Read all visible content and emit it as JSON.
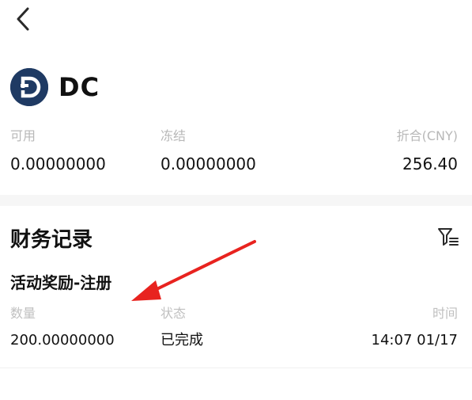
{
  "nav": {
    "back_icon": "chevron-left-icon"
  },
  "coin": {
    "symbol": "DC",
    "logo_letter": "D",
    "logo_color": "#1f3a63"
  },
  "balances": {
    "available": {
      "label": "可用",
      "value": "0.00000000"
    },
    "frozen": {
      "label": "冻结",
      "value": "0.00000000"
    },
    "converted": {
      "label": "折合(CNY)",
      "value": "256.40"
    }
  },
  "records": {
    "title": "财务记录",
    "filter_icon": "filter-icon",
    "items": [
      {
        "title": "活动奖励-注册",
        "amount_label": "数量",
        "amount": "200.00000000",
        "status_label": "状态",
        "status": "已完成",
        "time_label": "时间",
        "time": "14:07 01/17"
      }
    ]
  },
  "annotation": {
    "arrow_color": "#e8231f"
  }
}
